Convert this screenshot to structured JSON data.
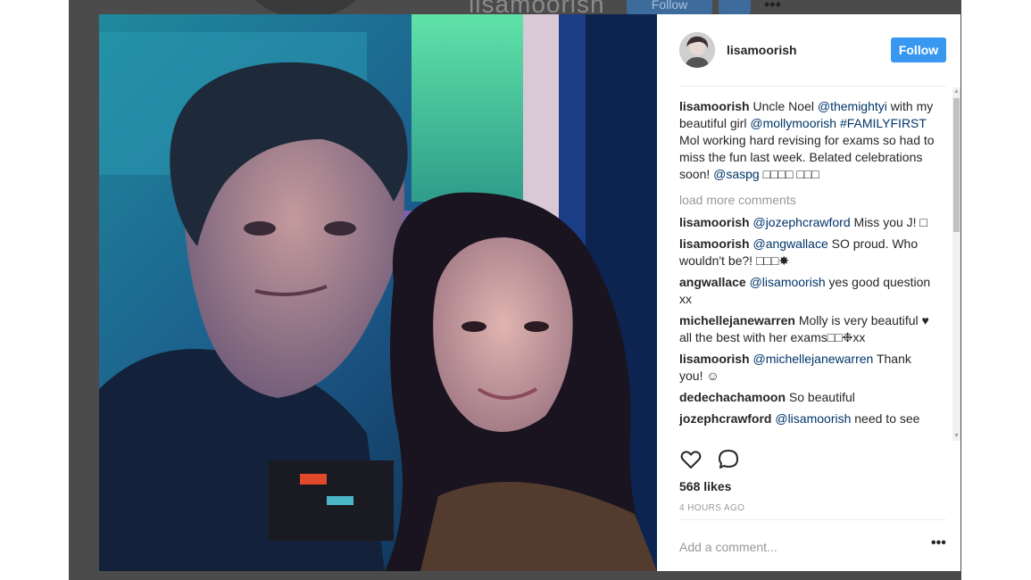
{
  "background": {
    "username": "lisamoorish",
    "follow_label": "Follow",
    "more_icon": "more-icon"
  },
  "post": {
    "username": "lisamoorish",
    "follow_label": "Follow",
    "caption": {
      "username": "lisamoorish",
      "parts": [
        {
          "text": " Uncle Noel ",
          "type": "text"
        },
        {
          "text": "@themightyi",
          "type": "mention"
        },
        {
          "text": " with my beautiful girl ",
          "type": "text"
        },
        {
          "text": "@mollymoorish",
          "type": "mention"
        },
        {
          "text": " ",
          "type": "text"
        },
        {
          "text": "#FAMILYFIRST",
          "type": "mention"
        },
        {
          "text": " Mol working hard revising for exams so had to miss the fun last week. Belated celebrations soon! ",
          "type": "text"
        },
        {
          "text": "@saspg",
          "type": "mention"
        },
        {
          "text": " □□□□ □□□",
          "type": "text"
        }
      ]
    },
    "load_more": "load more comments",
    "comments": [
      {
        "username": "lisamoorish",
        "parts": [
          {
            "text": " ",
            "type": "text"
          },
          {
            "text": "@jozephcrawford",
            "type": "mention"
          },
          {
            "text": " Miss you J! □",
            "type": "text"
          }
        ]
      },
      {
        "username": "lisamoorish",
        "parts": [
          {
            "text": " ",
            "type": "text"
          },
          {
            "text": "@angwallace",
            "type": "mention"
          },
          {
            "text": " SO proud. Who wouldn't be?! □□□✸",
            "type": "text"
          }
        ]
      },
      {
        "username": "angwallace",
        "parts": [
          {
            "text": " ",
            "type": "text"
          },
          {
            "text": "@lisamoorish",
            "type": "mention"
          },
          {
            "text": " yes good question xx",
            "type": "text"
          }
        ]
      },
      {
        "username": "michellejanewarren",
        "parts": [
          {
            "text": " Molly is very beautiful ♥ all the best with her exams□□❉xx",
            "type": "text"
          }
        ]
      },
      {
        "username": "lisamoorish",
        "parts": [
          {
            "text": " ",
            "type": "text"
          },
          {
            "text": "@michellejanewarren",
            "type": "mention"
          },
          {
            "text": " Thank you! ☺",
            "type": "text"
          }
        ]
      },
      {
        "username": "dedechachamoon",
        "parts": [
          {
            "text": " So beautiful",
            "type": "text"
          }
        ]
      },
      {
        "username": "jozephcrawford",
        "parts": [
          {
            "text": " ",
            "type": "text"
          },
          {
            "text": "@lisamoorish",
            "type": "mention"
          },
          {
            "text": " need to see",
            "type": "text"
          }
        ]
      }
    ],
    "likes": "568 likes",
    "time_ago": "4 HOURS AGO",
    "add_comment_placeholder": "Add a comment...",
    "more_options": "•••"
  },
  "colors": {
    "follow_button": "#3897f0",
    "mention": "#003569",
    "muted": "#999999",
    "text": "#262626"
  }
}
